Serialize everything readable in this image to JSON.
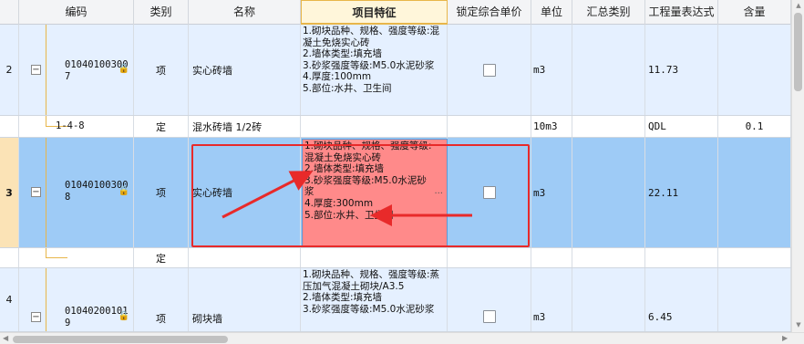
{
  "columns": [
    "编码",
    "类别",
    "名称",
    "项目特征",
    "锁定综合单价",
    "单位",
    "汇总类别",
    "工程量表达式",
    "含量"
  ],
  "rows": [
    {
      "num": "2",
      "code_line1": "01040100300",
      "code_line2": "7",
      "type": "项",
      "name": "实心砖墙",
      "features": [
        "1.砌块品种、规格、强度等级:混凝土免烧实心砖",
        "2.墙体类型:填充墙",
        "3.砂浆强度等级:M5.0水泥砂浆",
        "4.厚度:100mm",
        "5.部位:水井、卫生间"
      ],
      "unit": "m3",
      "expr": "11.73"
    },
    {
      "code": "1-4-8",
      "type": "定",
      "name": "混水砖墙 1/2砖",
      "unit": "10m3",
      "expr": "QDL",
      "qty": "0.1"
    },
    {
      "num": "3",
      "code_line1": "01040100300",
      "code_line2": "8",
      "type": "项",
      "name": "实心砖墙",
      "features": [
        "1.砌块品种、规格、强度等级:混凝土免烧实心砖",
        "2.墙体类型:填充墙",
        "3.砂浆强度等级:M5.0水泥砂浆",
        "4.厚度:300mm",
        "5.部位:水井、卫生间"
      ],
      "unit": "m3",
      "expr": "22.11"
    },
    {
      "type": "定"
    },
    {
      "num": "4",
      "code_line1": "01040200101",
      "code_line2": "9",
      "type": "项",
      "name": "砌块墙",
      "features": [
        "1.砌块品种、规格、强度等级:蒸压加气混凝土砌块/A3.5",
        "2.墙体类型:填充墙",
        "3.砂浆强度等级:M5.0水泥砂浆"
      ],
      "unit": "m3",
      "expr": "6.45"
    }
  ],
  "colors": {
    "selected_row": "#9ecbf6",
    "alt_row": "#e5f0ff",
    "annotation": "#e82a2a",
    "highlight_cell": "#ff8a8a"
  }
}
